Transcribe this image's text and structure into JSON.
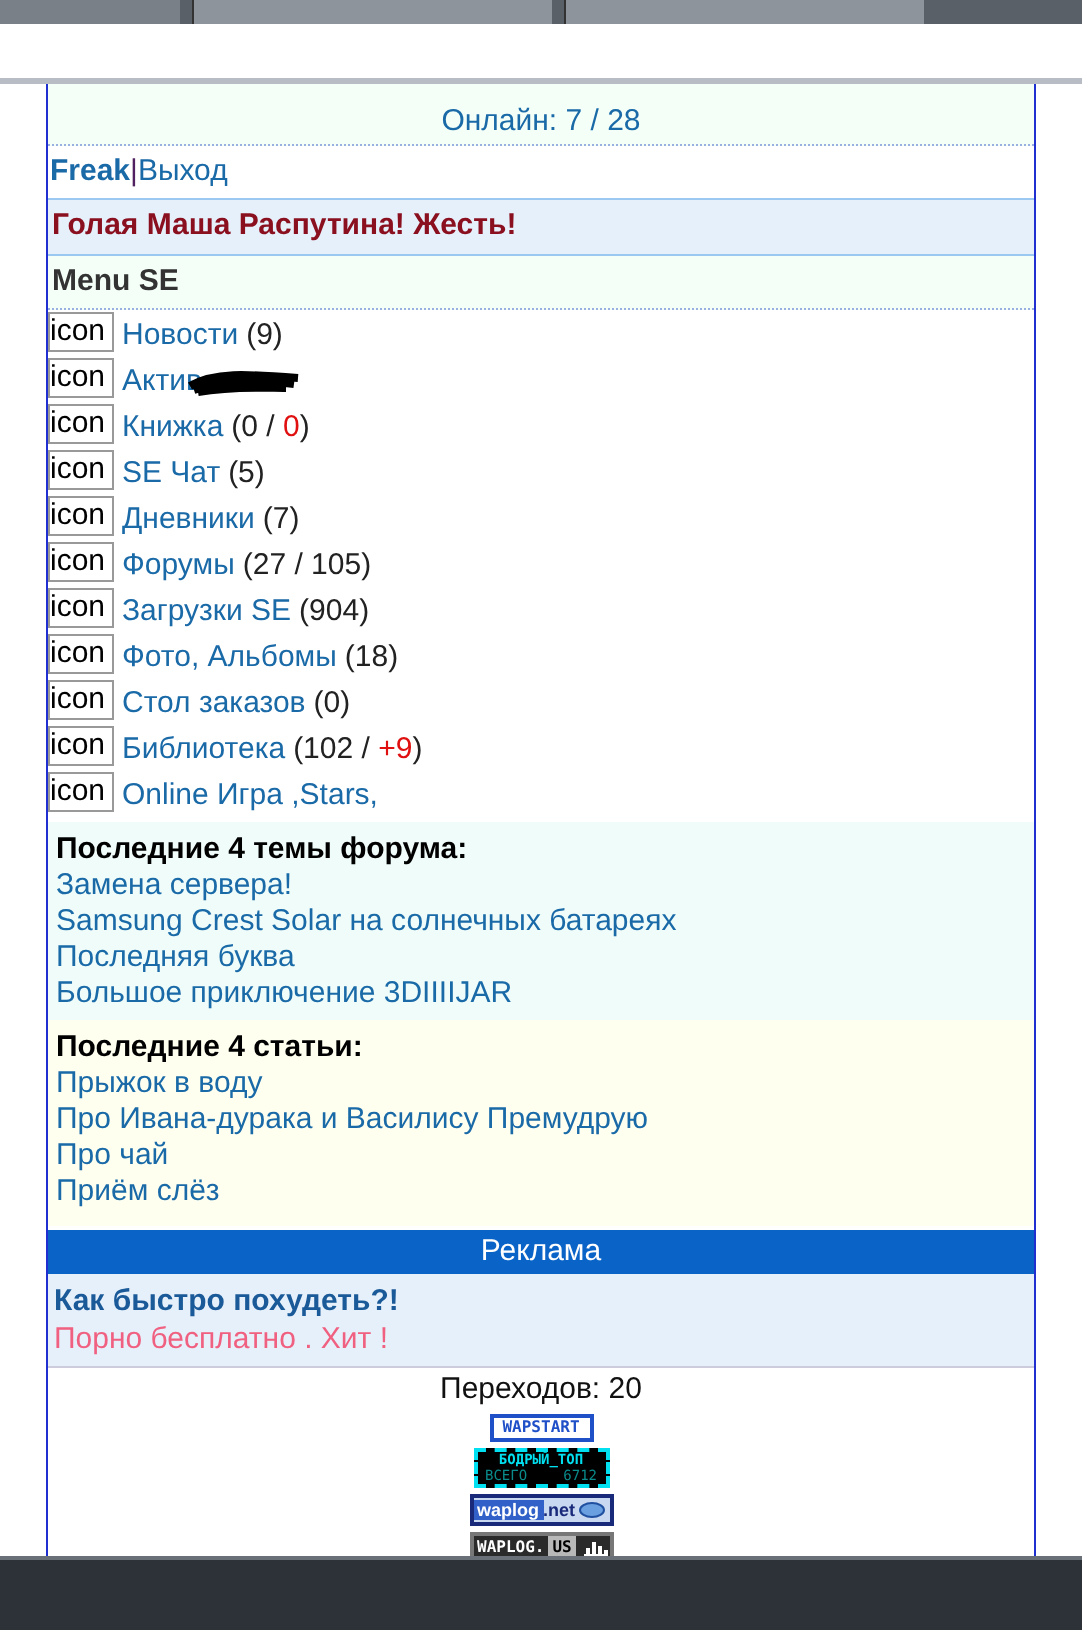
{
  "header": {
    "online": "Онлайн: 7 / 28"
  },
  "user": {
    "name": "Freak",
    "separator": "|",
    "logout": "Выход"
  },
  "headline": "Голая Маша Распутина! Жесть!",
  "menu": {
    "title": "Menu SE",
    "items": [
      {
        "icon": "icon",
        "label": "Новости",
        "count": [
          {
            "text": "(9)",
            "highlight": false
          }
        ]
      },
      {
        "icon": "icon",
        "label": "Актив",
        "redacted": true
      },
      {
        "icon": "icon",
        "label": "Книжка",
        "count": [
          {
            "text": "(0 / ",
            "highlight": false
          },
          {
            "text": "0",
            "highlight": true
          },
          {
            "text": ")",
            "highlight": false
          }
        ]
      },
      {
        "icon": "icon",
        "label": "SE Чат",
        "count": [
          {
            "text": "(5)",
            "highlight": false
          }
        ]
      },
      {
        "icon": "icon",
        "label": "Дневники",
        "count": [
          {
            "text": "(7)",
            "highlight": false
          }
        ]
      },
      {
        "icon": "icon",
        "label": "Форумы",
        "count": [
          {
            "text": "(27 / 105)",
            "highlight": false
          }
        ]
      },
      {
        "icon": "icon",
        "label": "Загрузки SE",
        "count": [
          {
            "text": "(904)",
            "highlight": false
          }
        ]
      },
      {
        "icon": "icon",
        "label": "Фото, Альбомы",
        "count": [
          {
            "text": "(18)",
            "highlight": false
          }
        ]
      },
      {
        "icon": "icon",
        "label": "Стол заказов",
        "count": [
          {
            "text": "(0)",
            "highlight": false
          }
        ]
      },
      {
        "icon": "icon",
        "label": "Библиотека",
        "count": [
          {
            "text": "(102 / ",
            "highlight": false
          },
          {
            "text": "+9",
            "highlight": true
          },
          {
            "text": ")",
            "highlight": false
          }
        ]
      },
      {
        "icon": "icon",
        "label": "Online Игра ,Stars,"
      }
    ]
  },
  "forum": {
    "title": "Последние 4 темы форума:",
    "links": [
      "Замена сервера!",
      "Samsung Crest Solar на солнечных батареях",
      "Последняя буква",
      "Большое приключение 3DIIIIJAR"
    ]
  },
  "articles": {
    "title": "Последние 4 статьи:",
    "links": [
      "Прыжок в воду",
      "Про Ивана-дурака и Василису Премудрую",
      "Про чай",
      "Приём слёз"
    ]
  },
  "ads": {
    "title": "Реклама",
    "links": [
      {
        "text": "Как быстро похудеть?!",
        "kind": "bold"
      },
      {
        "text": "Порно бесплатно . Хит !",
        "kind": "pink"
      }
    ]
  },
  "footer": {
    "visits": "Переходов: 20",
    "banners": [
      {
        "kind": "wapstart",
        "texts": [
          "WAPSTART"
        ]
      },
      {
        "kind": "top",
        "texts": [
          "БОДРЫЙ_ТОП",
          "ВСЕГО",
          "6712"
        ]
      },
      {
        "kind": "waplognet",
        "texts": [
          "waplog",
          ".net"
        ]
      },
      {
        "kind": "waplogus",
        "texts": [
          "WAPLOG.",
          "US"
        ]
      }
    ]
  }
}
